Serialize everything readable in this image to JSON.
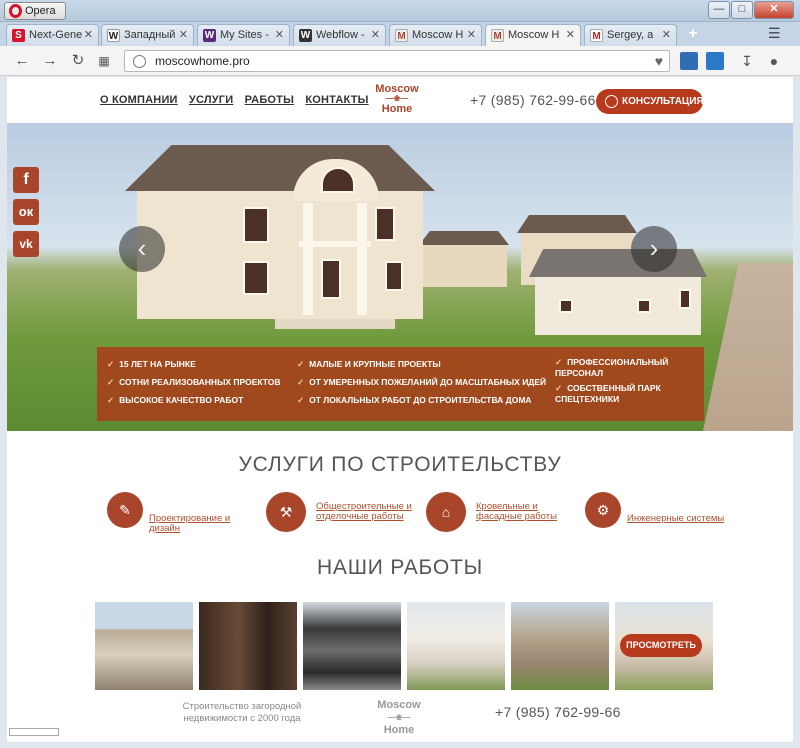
{
  "browser": {
    "app_name": "Opera",
    "tabs": [
      {
        "label": "Next-Gene",
        "favicon": "S",
        "color": "#d9122b"
      },
      {
        "label": "Западный",
        "favicon": "W",
        "color": "#333333"
      },
      {
        "label": "My Sites -",
        "favicon": "W",
        "color": "#5b2a7a"
      },
      {
        "label": "Webflow -",
        "favicon": "W",
        "color": "#333333"
      },
      {
        "label": "Moscow H",
        "favicon": "M",
        "color": "#888888"
      },
      {
        "label": "Moscow H",
        "favicon": "M",
        "color": "#888888"
      },
      {
        "label": "Sergey, a",
        "favicon": "M",
        "color": "#c5221f"
      }
    ],
    "active_tab_index": 5,
    "url": "moscowhome.pro",
    "extensions": [
      {
        "name": "css",
        "color": "#2f6db5"
      },
      {
        "name": "k",
        "color": "#2a78c6"
      }
    ]
  },
  "site": {
    "nav": [
      "О КОМПАНИИ",
      "УСЛУГИ",
      "РАБОТЫ",
      "КОНТАКТЫ"
    ],
    "logo_top": "Moscow",
    "logo_bottom": "Home",
    "phone": "+7 (985) 762-99-66",
    "consult_label": "КОНСУЛЬТАЦИЯ",
    "accent": "#b73a1d",
    "benefits": [
      "15 ЛЕТ НА РЫНКЕ",
      "СОТНИ РЕАЛИЗОВАННЫХ ПРОЕКТОВ",
      "ВЫСОКОЕ КАЧЕСТВО РАБОТ",
      "МАЛЫЕ И КРУПНЫЕ ПРОЕКТЫ",
      "ОТ УМЕРЕННЫХ ПОЖЕЛАНИЙ ДО МАСШТАБНЫХ ИДЕЙ",
      "ОТ ЛОКАЛЬНЫХ РАБОТ ДО СТРОИТЕЛЬСТВА ДОМА",
      "ПРОФЕССИОНАЛЬНЫЙ ПЕРСОНАЛ",
      "СОБСТВЕННЫЙ ПАРК СПЕЦТЕХНИКИ"
    ],
    "services_heading": "УСЛУГИ ПО СТРОИТЕЛЬСТВУ",
    "services": [
      {
        "label": "Проектирование и дизайн",
        "icon": "blueprint-icon"
      },
      {
        "label": "Общестроительные и отделочные работы",
        "icon": "crane-icon"
      },
      {
        "label": "Кровельные и фасадные работы",
        "icon": "roof-icon"
      },
      {
        "label": "Инженерные системы",
        "icon": "engineering-icon"
      }
    ],
    "works_heading": "НАШИ РАБОТЫ",
    "view_label": "ПРОСМОТРЕТЬ",
    "footer_text": "Строительство загородной недвижимости с 2000 года",
    "footer_phone": "+7 (985) 762-99-66"
  }
}
